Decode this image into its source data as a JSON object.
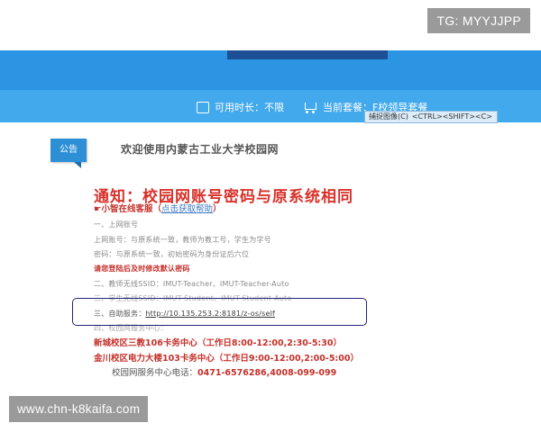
{
  "corner_tag": "TG: MYYJJPP",
  "info_bar": {
    "duration_label": "可用时长：",
    "duration_value": "不限",
    "package_label": "当前套餐：",
    "package_value": "F校领导套餐"
  },
  "capture_tip": {
    "label": "捕捉图像(C)",
    "shortcut": "<CTRL><SHIFT><C>"
  },
  "notice": {
    "tag": "公告",
    "welcome": "欢迎使用内蒙古工业大学校园网",
    "title": "通知：校园网账号密码与原系统相同",
    "subtitle_prefix": "☛小智在线客服（",
    "subtitle_link": "点击获取帮助",
    "subtitle_suffix": "）",
    "lines": {
      "l1": "一、上网账号",
      "l2": "上网账号：与原系统一致，教师为教工号，学生为学号",
      "l3": "密码：与原系统一致，初始密码为身份证后六位",
      "l4": "请您登陆后及时修改默认密码",
      "l5": "二、教师无线SSID：IMUT-Teacher、IMUT-Teacher-Auto",
      "l6": "三、学生无线SSID：IMUT-Student、IMUT-Student-Auto",
      "l7_prefix": "三、自助服务：",
      "l7_url": "http://10.135.253.2:8181/z-os/self",
      "l8": "四、校园网服务中心：",
      "center1": "新城校区三教106卡务中心（工作日8:00-12:00,2:30-5:30）",
      "center2": "金川校区电力大楼103卡务中心（工作日9:00-12:00,2:00-5:00）",
      "phone_label": "校园网服务中心电话：",
      "phone_value": "0471-6576286,4008-099-099"
    }
  },
  "watermark": "www.chn-k8kaifa.com"
}
